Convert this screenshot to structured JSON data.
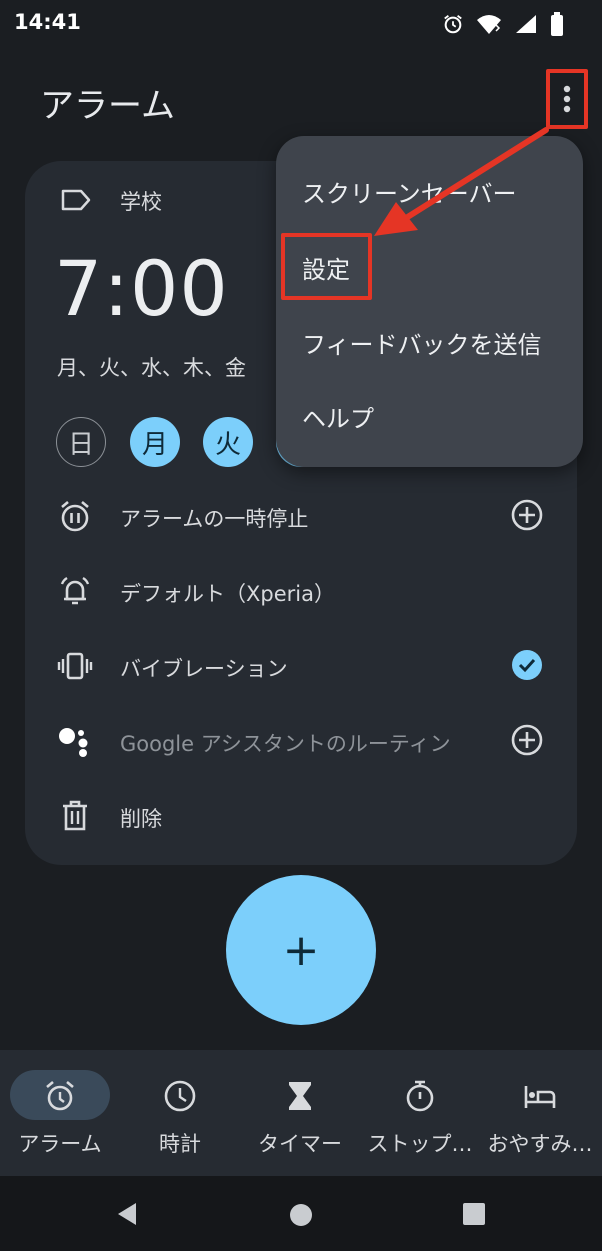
{
  "status_bar": {
    "time": "14:41",
    "icons": [
      "alarm-icon",
      "wifi-icon",
      "signal-icon",
      "battery-icon"
    ]
  },
  "header": {
    "title": "アラーム",
    "menu_icon": "more-vert-icon"
  },
  "alarm": {
    "label": "学校",
    "time": "7:00",
    "repeat_summary": "月、火、水、木、金",
    "days": [
      {
        "label": "日",
        "selected": false
      },
      {
        "label": "月",
        "selected": true
      },
      {
        "label": "火",
        "selected": true
      }
    ],
    "options": [
      {
        "icon": "alarm-pause-icon",
        "label": "アラームの一時停止",
        "action": "add-circle-icon"
      },
      {
        "icon": "bell-icon",
        "label": "デフォルト（Xperia）",
        "action": ""
      },
      {
        "icon": "vibration-icon",
        "label": "バイブレーション",
        "action": "check-circle-icon"
      },
      {
        "icon": "google-assistant-icon",
        "label": "Google アシスタントのルーティン",
        "action": "add-circle-icon"
      },
      {
        "icon": "trash-icon",
        "label": "削除",
        "action": ""
      }
    ]
  },
  "fab": {
    "label": "+"
  },
  "bottom_nav": {
    "items": [
      {
        "label": "アラーム",
        "icon": "alarm-icon",
        "active": true
      },
      {
        "label": "時計",
        "icon": "clock-icon",
        "active": false
      },
      {
        "label": "タイマー",
        "icon": "hourglass-icon",
        "active": false
      },
      {
        "label": "ストップ…",
        "icon": "stopwatch-icon",
        "active": false
      },
      {
        "label": "おやすみ…",
        "icon": "bed-icon",
        "active": false
      }
    ]
  },
  "overflow_menu": {
    "items": [
      {
        "label": "スクリーンセーバー"
      },
      {
        "label": "設定"
      },
      {
        "label": "フィードバックを送信"
      },
      {
        "label": "ヘルプ"
      }
    ]
  },
  "colors": {
    "background": "#1b1e22",
    "card": "#262b32",
    "accent": "#7ccffb",
    "menu": "#3f444c",
    "annotation": "#e53525"
  }
}
